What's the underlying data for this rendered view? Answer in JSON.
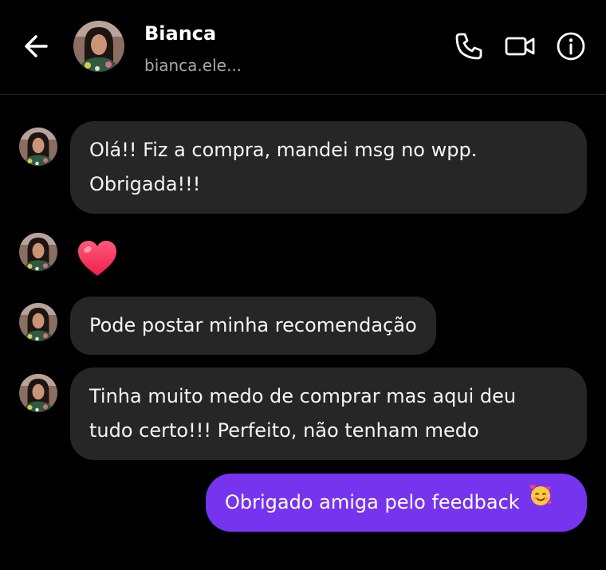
{
  "header": {
    "contact_name": "Bianca",
    "contact_handle": "bianca.ele..."
  },
  "messages": [
    {
      "sender": "contact",
      "type": "text",
      "lines": [
        "Olá!! Fiz a compra, mandei msg no wpp.",
        "Obrigada!!!"
      ]
    },
    {
      "sender": "contact",
      "type": "reaction",
      "icon": "heart-emoji"
    },
    {
      "sender": "contact",
      "type": "text",
      "lines": [
        "Pode postar minha recomendação"
      ]
    },
    {
      "sender": "contact",
      "type": "text",
      "lines": [
        "Tinha muito medo de comprar mas aqui deu",
        "tudo certo!!! Perfeito, não tenham medo"
      ]
    },
    {
      "sender": "me",
      "type": "text",
      "lines": [
        "Obrigado amiga pelo feedback"
      ],
      "emoji": "smiling-face-with-hearts"
    }
  ],
  "colors": {
    "background": "#000000",
    "incoming_bubble": "#262626",
    "outgoing_bubble": "#7634ef",
    "secondary_text": "#a8a8a8"
  },
  "icons": [
    "back-arrow-icon",
    "phone-icon",
    "video-camera-icon",
    "info-icon"
  ]
}
